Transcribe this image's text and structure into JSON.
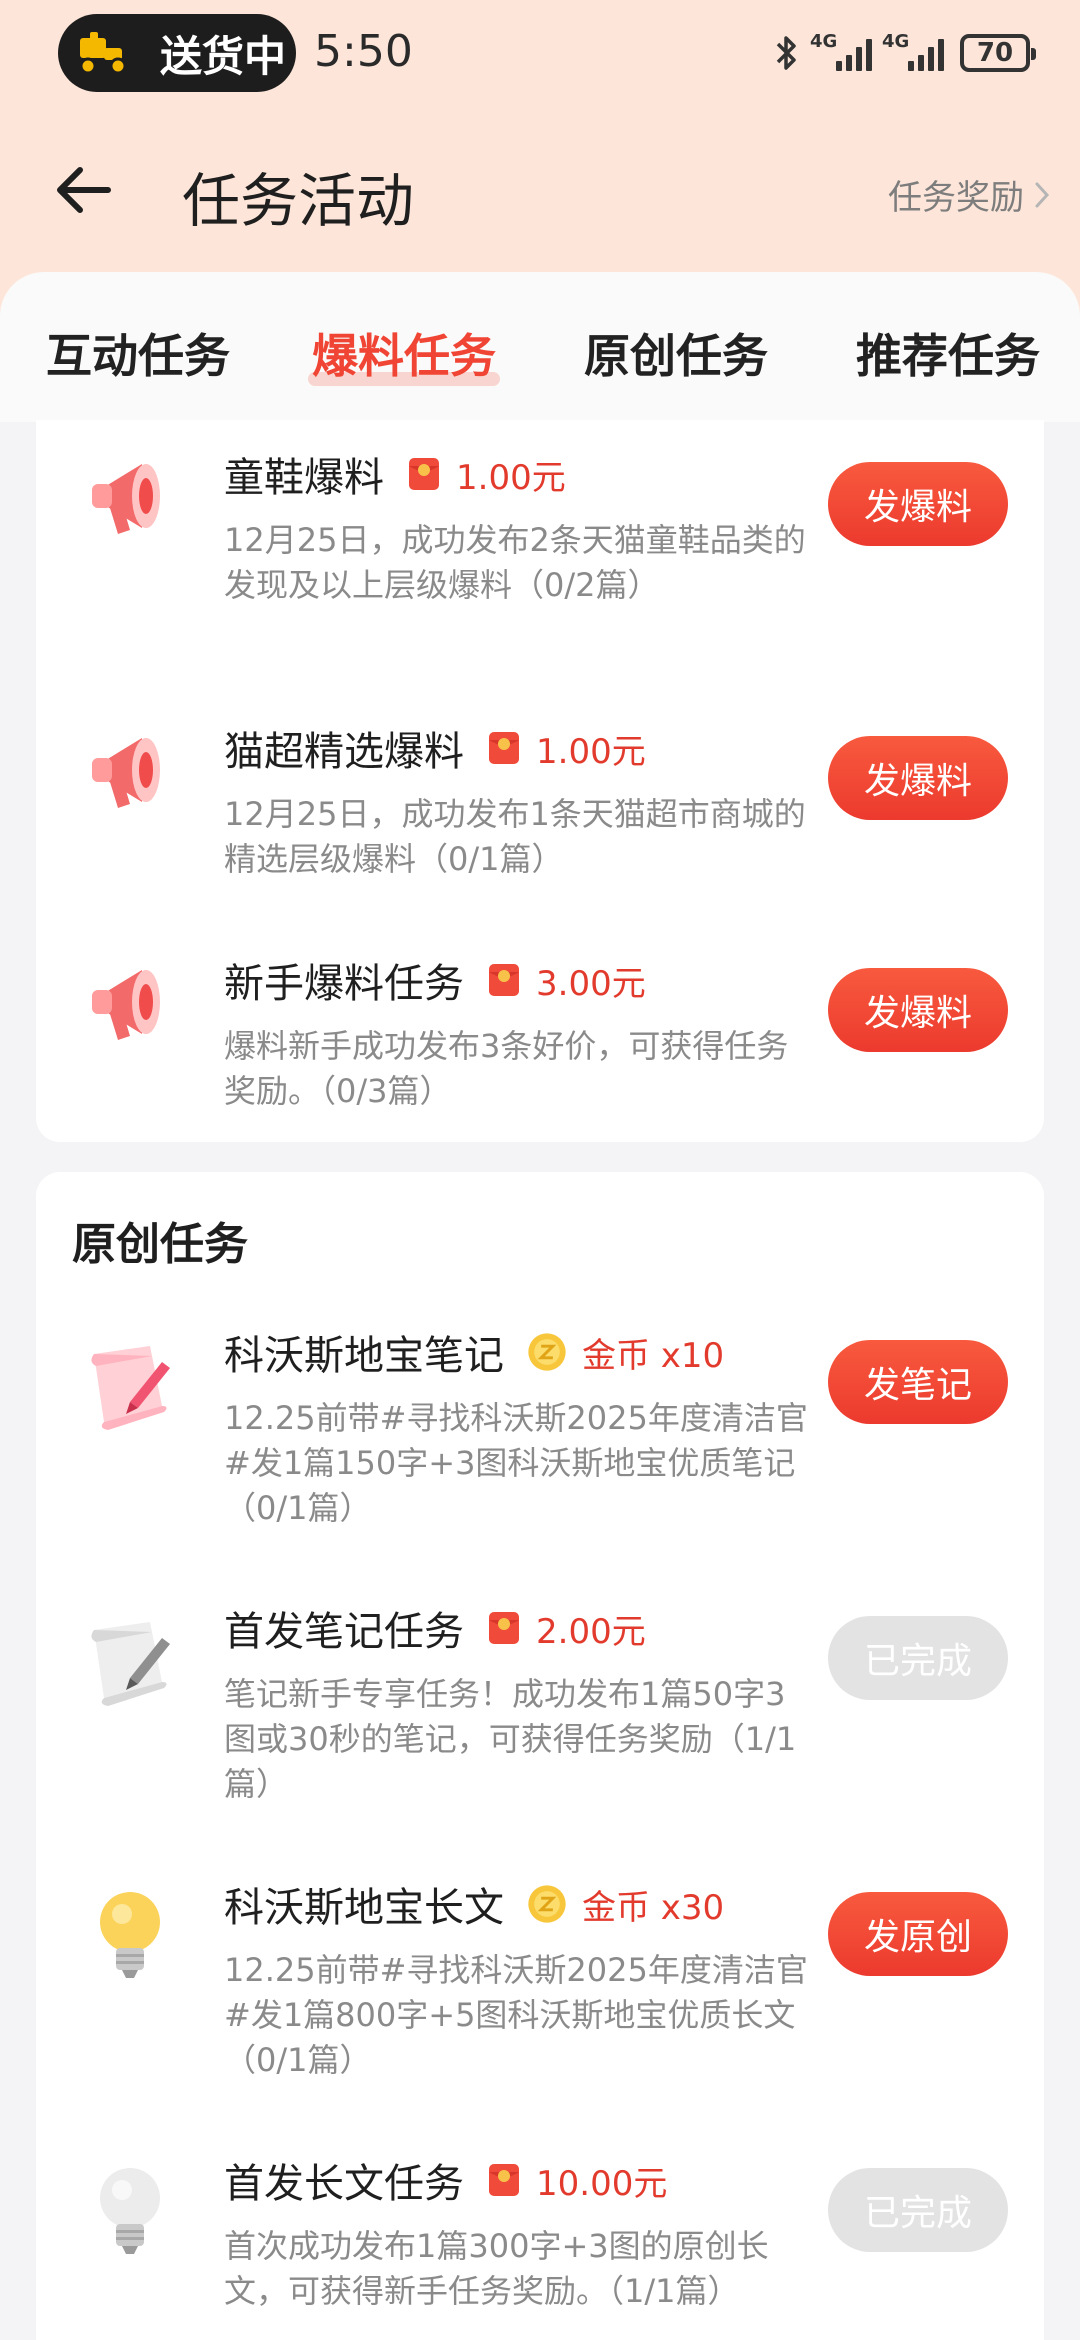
{
  "status_bar": {
    "delivery_label": "送货中",
    "time": "5:50",
    "network_1": "4G",
    "network_2": "4G",
    "battery": "70"
  },
  "header": {
    "title": "任务活动",
    "reward_link": "任务奖励"
  },
  "tabs": [
    {
      "label": "互动任务",
      "active": false
    },
    {
      "label": "爆料任务",
      "active": true
    },
    {
      "label": "原创任务",
      "active": false
    },
    {
      "label": "推荐任务",
      "active": false
    }
  ],
  "baoliao_tasks": [
    {
      "title": "童鞋爆料",
      "reward_type": "red-packet",
      "reward": "1.00元",
      "desc": "12月25日，成功发布2条天猫童鞋品类的发现及以上层级爆料（0/2篇）",
      "button": "发爆料",
      "done": false,
      "icon": "megaphone-icon"
    },
    {
      "title": "猫超精选爆料",
      "reward_type": "red-packet",
      "reward": "1.00元",
      "desc": "12月25日，成功发布1条天猫超市商城的精选层级爆料（0/1篇）",
      "button": "发爆料",
      "done": false,
      "icon": "megaphone-icon"
    },
    {
      "title": "新手爆料任务",
      "reward_type": "red-packet",
      "reward": "3.00元",
      "desc": "爆料新手成功发布3条好价，可获得任务奖励。（0/3篇）",
      "button": "发爆料",
      "done": false,
      "icon": "megaphone-icon"
    }
  ],
  "original_section": {
    "title": "原创任务",
    "tasks": [
      {
        "title": "科沃斯地宝笔记",
        "reward_type": "coin",
        "reward": "金币 x10",
        "desc": "12.25前带#寻找科沃斯2025年度清洁官#发1篇150字+3图科沃斯地宝优质笔记（0/1篇）",
        "button": "发笔记",
        "done": false,
        "icon": "note-pen-icon"
      },
      {
        "title": "首发笔记任务",
        "reward_type": "red-packet",
        "reward": "2.00元",
        "desc": "笔记新手专享任务！成功发布1篇50字3图或30秒的笔记，可获得任务奖励（1/1篇）",
        "button": "已完成",
        "done": true,
        "icon": "note-pen-icon"
      },
      {
        "title": "科沃斯地宝长文",
        "reward_type": "coin",
        "reward": "金币 x30",
        "desc": "12.25前带#寻找科沃斯2025年度清洁官#发1篇800字+5图科沃斯地宝优质长文（0/1篇）",
        "button": "发原创",
        "done": false,
        "icon": "lightbulb-icon"
      },
      {
        "title": "首发长文任务",
        "reward_type": "red-packet",
        "reward": "10.00元",
        "desc": "首次成功发布1篇300字+3图的原创长文，可获得新手任务奖励。（1/1篇）",
        "button": "已完成",
        "done": true,
        "icon": "lightbulb-icon"
      }
    ]
  },
  "colors": {
    "accent": "#f04534",
    "header_bg": "#fde6d9",
    "button_gradient_top": "#f85a3e",
    "button_gradient_bottom": "#ec3a2e",
    "done_button": "#e3e3e3",
    "desc_text": "#8a8a8a"
  }
}
